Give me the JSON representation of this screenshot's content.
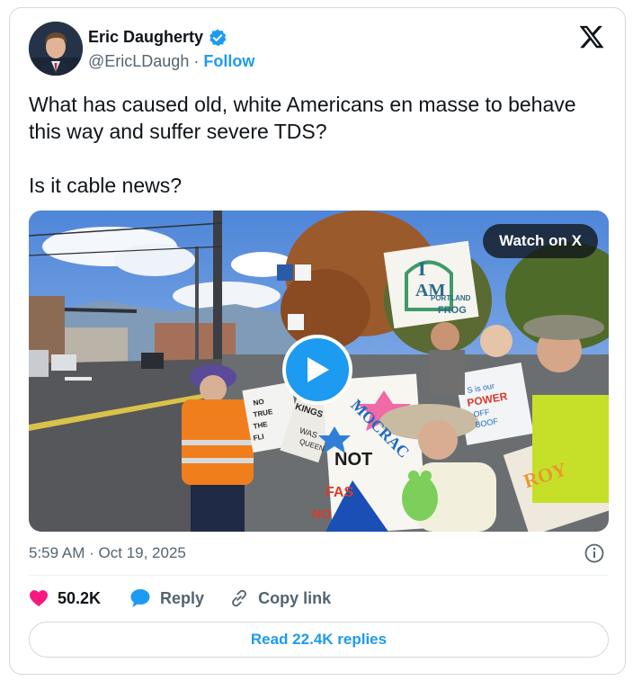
{
  "author": {
    "name": "Eric Daugherty",
    "handle": "@EricLDaugh",
    "separator": "·",
    "follow_label": "Follow"
  },
  "tweet": {
    "text": "What has caused old, white Americans en masse to behave this way and suffer severe TDS?\n\nIs it cable news?"
  },
  "media": {
    "watch_label": "Watch on X",
    "sign_texts": [
      "I",
      "AM",
      "PORTLAND",
      "FROG",
      "NOT",
      "MOCRAC",
      "KINGS",
      "NO",
      "TRUE",
      "THE",
      "FLI",
      "WAS",
      "QUEEN",
      "ROY",
      "FAS",
      "NO",
      "S is our",
      "POWER",
      "OFF",
      "BOOF"
    ]
  },
  "meta": {
    "time": "5:59 AM",
    "separator": "·",
    "date": "Oct 19, 2025"
  },
  "actions": {
    "like_count": "50.2K",
    "reply_label": "Reply",
    "copy_label": "Copy link"
  },
  "read_replies_label": "Read 22.4K replies",
  "colors": {
    "accent": "#1d9bf0",
    "like": "#f91880",
    "text": "#0f1419",
    "muted": "#536471",
    "border": "#cfd9de"
  }
}
